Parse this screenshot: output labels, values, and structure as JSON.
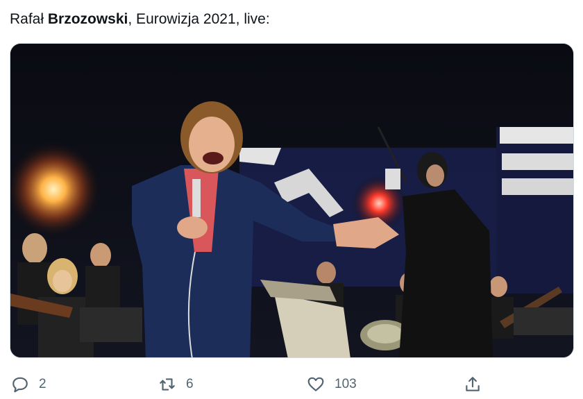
{
  "tweet": {
    "text_prefix": "Rafał ",
    "text_bold": "Brzozowski",
    "text_suffix": ", Eurowizja 2021, live:"
  },
  "media": {
    "type": "video-still",
    "description_colors": {
      "background": "#05060a",
      "jacket": "#1d2d5a",
      "shirt": "#d9575a",
      "light": "#ffb347"
    }
  },
  "actions": {
    "reply_count": "2",
    "retweet_count": "6",
    "like_count": "103"
  },
  "icons": {
    "reply": "reply-icon",
    "retweet": "retweet-icon",
    "like": "like-icon",
    "share": "share-icon"
  }
}
